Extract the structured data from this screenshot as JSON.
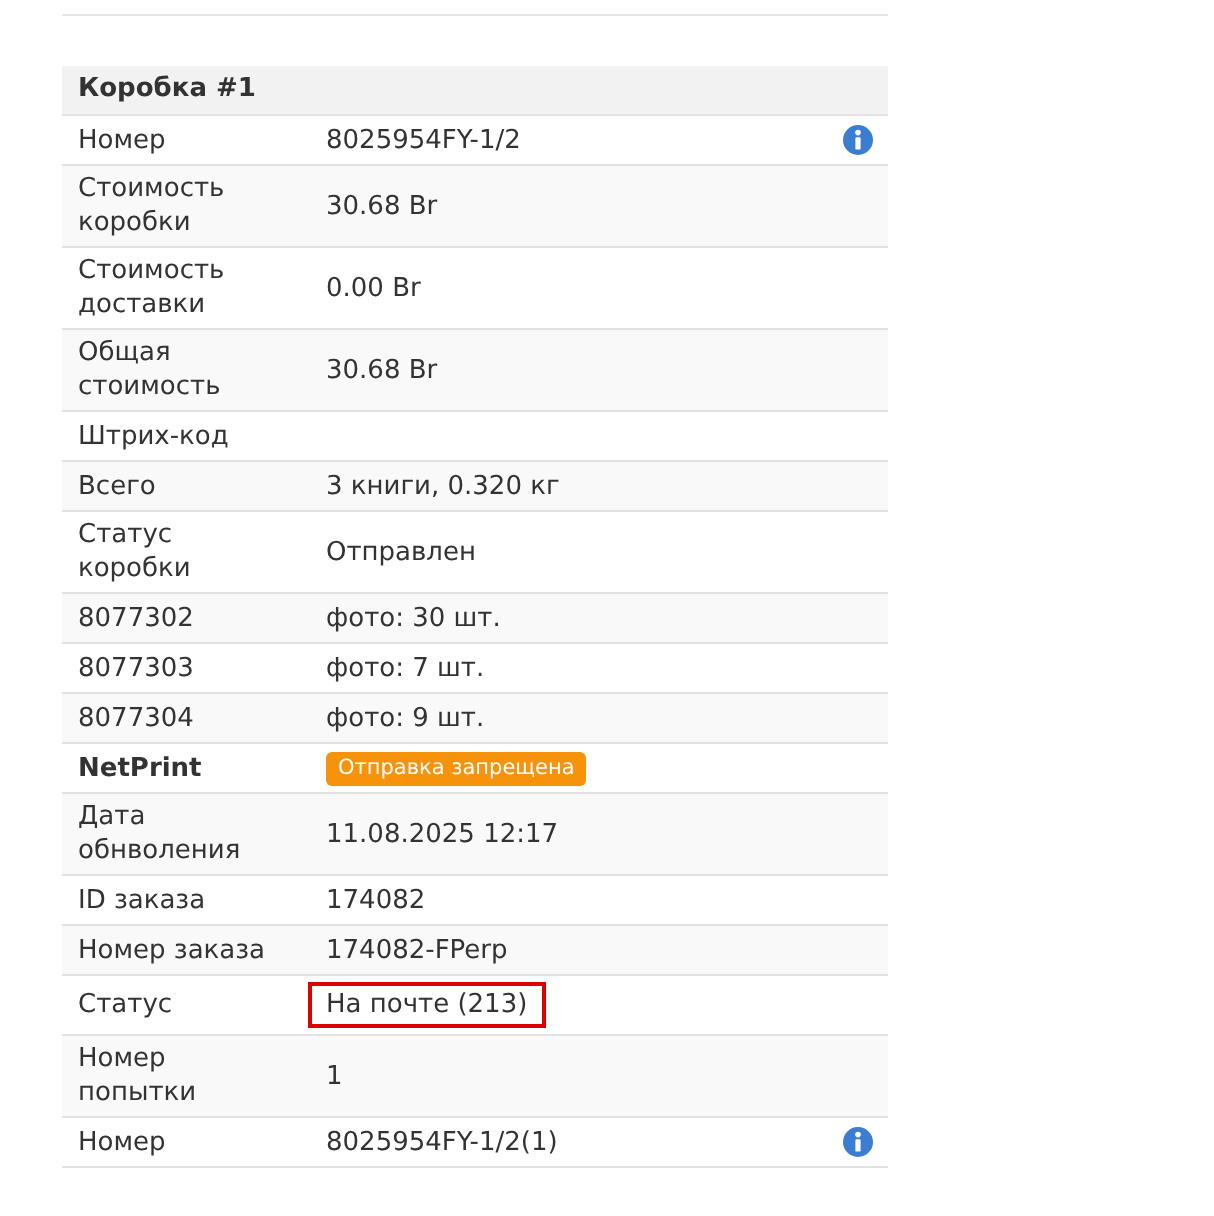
{
  "box": {
    "title": "Коробка #1",
    "rows": [
      {
        "kind": "field",
        "label": "Номер",
        "value": "8025954FY-1/2",
        "info": true
      },
      {
        "kind": "field",
        "label": "Стоимость коробки",
        "value": "30.68 Br"
      },
      {
        "kind": "field",
        "label": "Стоимость доставки",
        "value": "0.00 Br"
      },
      {
        "kind": "field",
        "label": "Общая стоимость",
        "value": "30.68 Br"
      },
      {
        "kind": "field",
        "label": "Штрих-код"
      },
      {
        "kind": "field",
        "label": "Всего",
        "value": "3 книги, 0.320 кг"
      },
      {
        "kind": "field",
        "label": "Статус коробки",
        "value": "Отправлен"
      },
      {
        "kind": "field",
        "label": "8077302",
        "value": "фото: 30 шт."
      },
      {
        "kind": "field",
        "label": "8077303",
        "value": "фото: 7 шт."
      },
      {
        "kind": "field",
        "label": "8077304",
        "value": "фото: 9 шт."
      },
      {
        "kind": "section",
        "label": "NetPrint",
        "badge": "Отправка запрещена"
      },
      {
        "kind": "field",
        "label": "Дата обнволения",
        "value": "11.08.2025 12:17"
      },
      {
        "kind": "field",
        "label": "ID заказа",
        "value": "174082"
      },
      {
        "kind": "field",
        "label": "Номер заказа",
        "value": "174082-FPerp"
      },
      {
        "kind": "field",
        "label": "Статус",
        "value": "На почте (213)",
        "highlighted": true
      },
      {
        "kind": "field",
        "label": "Номер попытки",
        "value": "1"
      },
      {
        "kind": "field",
        "label": "Номер",
        "value": "8025954FY-1/2(1)",
        "info": true
      }
    ]
  }
}
